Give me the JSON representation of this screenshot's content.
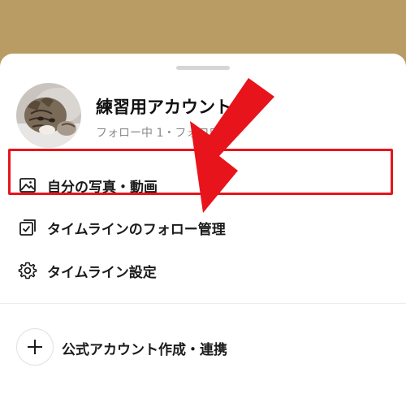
{
  "colors": {
    "background_band": "#b99c63",
    "highlight": "#e8141c",
    "arrow": "#e8141c"
  },
  "account": {
    "name": "練習用アカウント",
    "follow_stats": "フォロー中 1・フォロワー",
    "avatar": "cat-photo"
  },
  "menu": {
    "items": [
      {
        "label": "自分の写真・動画",
        "icon": "image-icon"
      },
      {
        "label": "タイムラインのフォロー管理",
        "icon": "follow-manage-icon"
      },
      {
        "label": "タイムライン設定",
        "icon": "gear-icon"
      }
    ]
  },
  "create": {
    "label": "公式アカウント作成・連携",
    "icon": "plus-icon"
  }
}
